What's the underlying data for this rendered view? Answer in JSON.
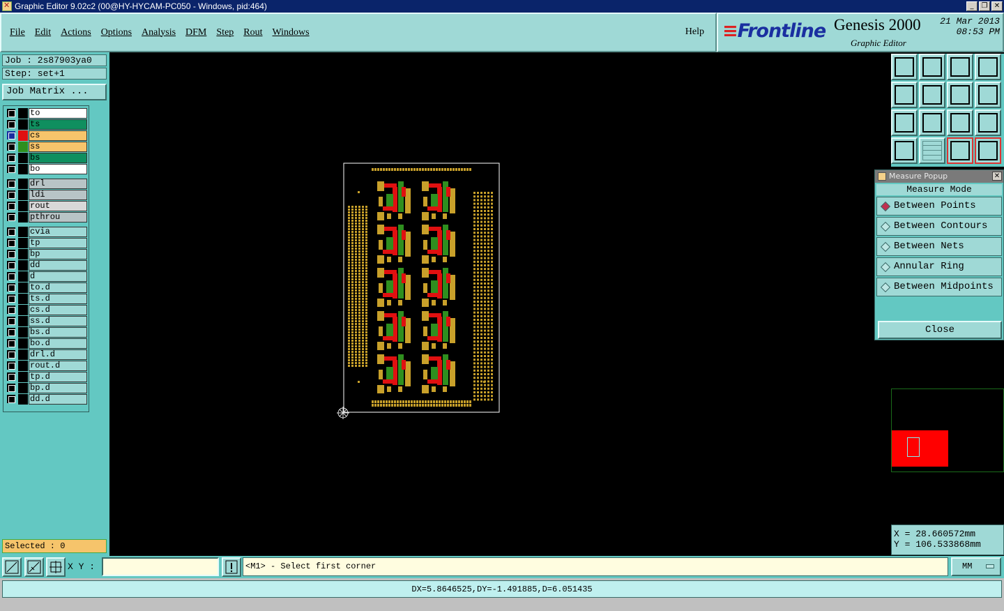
{
  "window": {
    "title": "Graphic Editor 9.02c2 (00@HY-HYCAM-PC050 - Windows, pid:464)"
  },
  "menu": [
    "File",
    "Edit",
    "Actions",
    "Options",
    "Analysis",
    "DFM",
    "Step",
    "Rout",
    "Windows"
  ],
  "help": "Help",
  "brand": {
    "logo": "Frontline",
    "product": "Genesis 2000",
    "subtitle": "Graphic Editor",
    "date": "21 Mar 2013",
    "time": "08:53 PM"
  },
  "job": {
    "job_line": "Job : 2s87903ya0",
    "step_line": "Step: set+1",
    "matrix_button": "Job Matrix ..."
  },
  "layers": [
    {
      "name": "to",
      "bg": "#ffffff",
      "swatch": "#000000",
      "active": false
    },
    {
      "name": "ts",
      "bg": "#0f8f5f",
      "swatch": "#000000",
      "active": false
    },
    {
      "name": "cs",
      "bg": "#f6c46b",
      "swatch": "#e01010",
      "active": true
    },
    {
      "name": "ss",
      "bg": "#f6c46b",
      "swatch": "#2f8f1f",
      "active": false
    },
    {
      "name": "bs",
      "bg": "#0f8f5f",
      "swatch": "#000000",
      "active": false
    },
    {
      "name": "bo",
      "bg": "#ffffff",
      "swatch": "#000000",
      "active": false
    },
    {
      "name": "drl",
      "bg": "#b8c4c6",
      "swatch": "#000000",
      "active": false
    },
    {
      "name": "ldi",
      "bg": "#b8c4c6",
      "swatch": "#000000",
      "active": false
    },
    {
      "name": "rout",
      "bg": "#d8d8d8",
      "swatch": "#000000",
      "active": false
    },
    {
      "name": "pthrou",
      "bg": "#b8c4c6",
      "swatch": "#000000",
      "active": false
    },
    {
      "name": "cvia",
      "bg": "#9fd9d6",
      "swatch": "#000000",
      "active": false
    },
    {
      "name": "tp",
      "bg": "#9fd9d6",
      "swatch": "#000000",
      "active": false
    },
    {
      "name": "bp",
      "bg": "#9fd9d6",
      "swatch": "#000000",
      "active": false
    },
    {
      "name": "dd",
      "bg": "#9fd9d6",
      "swatch": "#000000",
      "active": false
    },
    {
      "name": "d",
      "bg": "#9fd9d6",
      "swatch": "#000000",
      "active": false
    },
    {
      "name": "to.d",
      "bg": "#9fd9d6",
      "swatch": "#000000",
      "active": false
    },
    {
      "name": "ts.d",
      "bg": "#9fd9d6",
      "swatch": "#000000",
      "active": false
    },
    {
      "name": "cs.d",
      "bg": "#9fd9d6",
      "swatch": "#000000",
      "active": false
    },
    {
      "name": "ss.d",
      "bg": "#9fd9d6",
      "swatch": "#000000",
      "active": false
    },
    {
      "name": "bs.d",
      "bg": "#9fd9d6",
      "swatch": "#000000",
      "active": false
    },
    {
      "name": "bo.d",
      "bg": "#9fd9d6",
      "swatch": "#000000",
      "active": false
    },
    {
      "name": "drl.d",
      "bg": "#9fd9d6",
      "swatch": "#000000",
      "active": false
    },
    {
      "name": "rout.d",
      "bg": "#9fd9d6",
      "swatch": "#000000",
      "active": false
    },
    {
      "name": "tp.d",
      "bg": "#9fd9d6",
      "swatch": "#000000",
      "active": false
    },
    {
      "name": "bp.d",
      "bg": "#9fd9d6",
      "swatch": "#000000",
      "active": false
    },
    {
      "name": "dd.d",
      "bg": "#9fd9d6",
      "swatch": "#000000",
      "active": false
    }
  ],
  "selected": "Selected : 0",
  "toolbar_icons": [
    "zoom-home-icon",
    "zoom-home-down-icon",
    "home-icon",
    "window-icon",
    "pan-left-icon",
    "pan-right-icon",
    "flip-icon",
    "snap-icon",
    "fit-icon",
    "center-icon",
    "scale-icon",
    "help-query-icon",
    "tools-icon",
    "grid-icon",
    "net-icon",
    "net-alt-icon"
  ],
  "measure_popup": {
    "title": "Measure Popup",
    "mode_label": "Measure Mode",
    "options": [
      "Between Points",
      "Between Contours",
      "Between Nets",
      "Annular Ring",
      "Between Midpoints"
    ],
    "selected_index": 0,
    "close_label": "Close"
  },
  "coords": {
    "x": "X  =  28.660572mm",
    "y": "Y  = 106.533868mm"
  },
  "bottom": {
    "xy_label": "X Y :",
    "xy_value": "",
    "prompt": "<M1> - Select first corner",
    "unit": "MM"
  },
  "status": "DX=5.8646525,DY=-1.491885,D=6.051435",
  "colors": {
    "pad": "#c8a02a",
    "cs": "#e01010",
    "ss": "#2f8f1f",
    "outline": "#ffffff"
  }
}
